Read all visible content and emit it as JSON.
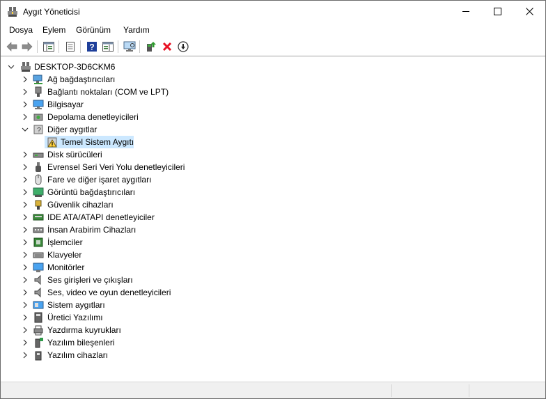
{
  "window": {
    "title": "Aygıt Yöneticisi"
  },
  "menu": [
    "Dosya",
    "Eylem",
    "Görünüm",
    "Yardım"
  ],
  "toolbar": {
    "icons": [
      "back-arrow-icon",
      "forward-arrow-icon",
      "show-hide-console-tree-icon",
      "properties-icon",
      "help-icon",
      "action-pane-icon",
      "scan-hardware-changes-icon",
      "update-driver-icon",
      "uninstall-device-icon",
      "disable-device-icon"
    ]
  },
  "tree": {
    "root": "DESKTOP-3D6CKM6",
    "categories": [
      {
        "label": "Ağ bağdaştırıcıları",
        "icon": "network-adapter-icon",
        "expanded": false
      },
      {
        "label": "Bağlantı noktaları (COM ve LPT)",
        "icon": "port-icon",
        "expanded": false
      },
      {
        "label": "Bilgisayar",
        "icon": "computer-icon",
        "expanded": false
      },
      {
        "label": "Depolama denetleyicileri",
        "icon": "storage-controller-icon",
        "expanded": false
      },
      {
        "label": "Diğer aygıtlar",
        "icon": "other-devices-icon",
        "expanded": true,
        "children": [
          {
            "label": "Temel Sistem Aygıtı",
            "icon": "warning-device-icon"
          }
        ]
      },
      {
        "label": "Disk sürücüleri",
        "icon": "disk-drive-icon",
        "expanded": false
      },
      {
        "label": "Evrensel Seri Veri Yolu denetleyicileri",
        "icon": "usb-icon",
        "expanded": false
      },
      {
        "label": "Fare ve diğer işaret aygıtları",
        "icon": "mouse-icon",
        "expanded": false
      },
      {
        "label": "Görüntü bağdaştırıcıları",
        "icon": "display-adapter-icon",
        "expanded": false
      },
      {
        "label": "Güvenlik cihazları",
        "icon": "security-device-icon",
        "expanded": false
      },
      {
        "label": "IDE ATA/ATAPI denetleyiciler",
        "icon": "ide-controller-icon",
        "expanded": false
      },
      {
        "label": "İnsan Arabirim Cihazları",
        "icon": "hid-icon",
        "expanded": false
      },
      {
        "label": "İşlemciler",
        "icon": "processor-icon",
        "expanded": false
      },
      {
        "label": "Klavyeler",
        "icon": "keyboard-icon",
        "expanded": false
      },
      {
        "label": "Monitörler",
        "icon": "monitor-icon",
        "expanded": false
      },
      {
        "label": "Ses girişleri ve çıkışları",
        "icon": "audio-io-icon",
        "expanded": false
      },
      {
        "label": "Ses, video ve oyun denetleyicileri",
        "icon": "sound-video-icon",
        "expanded": false
      },
      {
        "label": "Sistem aygıtları",
        "icon": "system-devices-icon",
        "expanded": false
      },
      {
        "label": "Üretici Yazılımı",
        "icon": "firmware-icon",
        "expanded": false
      },
      {
        "label": "Yazdırma kuyrukları",
        "icon": "print-queue-icon",
        "expanded": false
      },
      {
        "label": "Yazılım bileşenleri",
        "icon": "software-component-icon",
        "expanded": false
      },
      {
        "label": "Yazılım cihazları",
        "icon": "software-device-icon",
        "expanded": false
      }
    ]
  },
  "colors": {
    "selection": "#cce8ff",
    "close_red": "#e81123",
    "help_blue": "#1e3f9a"
  }
}
